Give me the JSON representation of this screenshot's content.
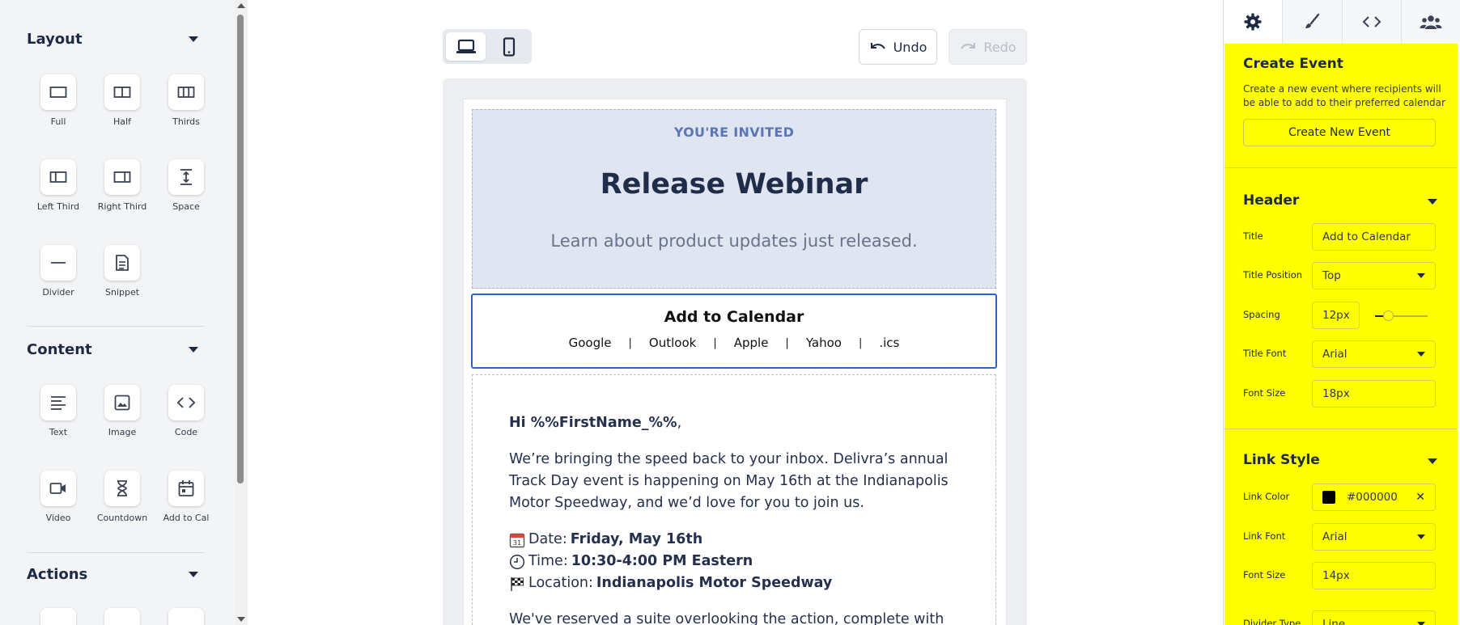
{
  "left_panel": {
    "sections": [
      {
        "title": "Layout",
        "items": [
          {
            "label": "Full",
            "icon": "full-layout-icon"
          },
          {
            "label": "Half",
            "icon": "half-layout-icon"
          },
          {
            "label": "Thirds",
            "icon": "thirds-layout-icon"
          },
          {
            "label": "Left Third",
            "icon": "left-third-layout-icon"
          },
          {
            "label": "Right Third",
            "icon": "right-third-layout-icon"
          },
          {
            "label": "Space",
            "icon": "space-icon"
          },
          {
            "label": "Divider",
            "icon": "divider-icon"
          },
          {
            "label": "Snippet",
            "icon": "snippet-icon"
          }
        ]
      },
      {
        "title": "Content",
        "items": [
          {
            "label": "Text",
            "icon": "text-icon"
          },
          {
            "label": "Image",
            "icon": "image-icon"
          },
          {
            "label": "Code",
            "icon": "code-icon"
          },
          {
            "label": "Video",
            "icon": "video-icon"
          },
          {
            "label": "Countdown",
            "icon": "hourglass-icon"
          },
          {
            "label": "Add to Cal",
            "icon": "calendar-icon"
          }
        ]
      },
      {
        "title": "Actions",
        "items": []
      }
    ]
  },
  "toolbar": {
    "undo_label": "Undo",
    "redo_label": "Redo"
  },
  "email": {
    "hero": {
      "kicker": "YOU'RE INVITED",
      "title": "Release Webinar",
      "subtitle": "Learn about product updates just released."
    },
    "calendar": {
      "title": "Add to Calendar",
      "links": [
        "Google",
        "Outlook",
        "Apple",
        "Yahoo",
        ".ics"
      ],
      "separator": "|"
    },
    "body": {
      "greeting_bold": "Hi %%FirstName_%%",
      "greeting_tail": ",",
      "paragraph1": "We’re bringing the speed back to your inbox. Delivra’s annual Track Day event is happening on May 16th at the Indianapolis Motor Speedway, and we’d love for you to join us.",
      "date_label": "Date:",
      "date_value": "Friday, May 16th",
      "time_label": "Time:",
      "time_value": "10:30-4:00 PM Eastern",
      "location_label": "Location:",
      "location_value": "Indianapolis Motor Speedway",
      "paragraph2": "We've reserved a suite overlooking the action, complete with lunch,"
    }
  },
  "right_panel": {
    "tabs": [
      "gear-icon",
      "brush-icon",
      "code-icon",
      "users-icon"
    ],
    "create_event": {
      "title": "Create Event",
      "description": "Create a new event where recipients will be able to add to their preferred calendar",
      "button": "Create New Event"
    },
    "header": {
      "title": "Header",
      "fields": {
        "title_label": "Title",
        "title_value": "Add to Calendar",
        "position_label": "Title Position",
        "position_value": "Top",
        "spacing_label": "Spacing",
        "spacing_value": "12px",
        "font_label": "Title Font",
        "font_value": "Arial",
        "size_label": "Font Size",
        "size_value": "18px"
      }
    },
    "link_style": {
      "title": "Link Style",
      "fields": {
        "color_label": "Link Color",
        "color_value": "#000000",
        "font_label": "Link Font",
        "font_value": "Arial",
        "size_label": "Font Size",
        "size_value": "14px",
        "divider_label": "Divider Type",
        "divider_value": "Line"
      }
    },
    "accent_color": "#ffff00"
  }
}
